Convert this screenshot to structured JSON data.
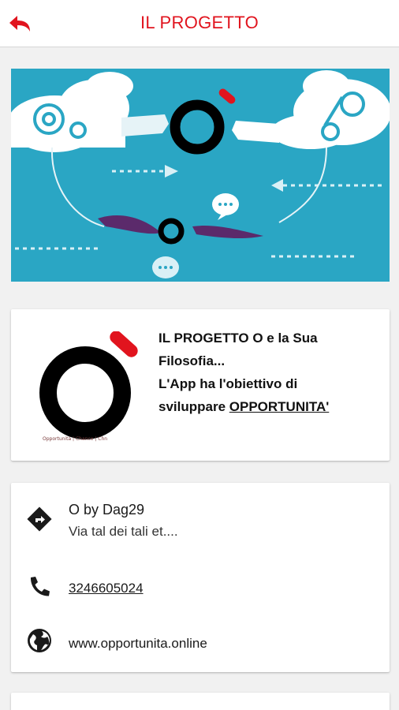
{
  "appbar": {
    "title": "IL PROGETTO",
    "back_icon": "back-arrow-icon",
    "accent": "#e1141e"
  },
  "hero": {
    "image": "opportunita-illustration",
    "background": "#2aa6c4"
  },
  "intro": {
    "logo_caption": "Opportunità | Chance | Chn",
    "line1": "IL PROGETTO O e la Sua",
    "line2": "Filosofia...",
    "line3": "L'App ha l'obiettivo di",
    "line4_prefix": "sviluppare ",
    "line4_link": "OPPORTUNITA'"
  },
  "contact": {
    "name": "O by Dag29",
    "address": "Via tal dei tali et....",
    "phone": "3246605024",
    "website": "www.opportunita.online",
    "icons": [
      "directions-icon",
      "phone-icon",
      "globe-icon"
    ]
  }
}
